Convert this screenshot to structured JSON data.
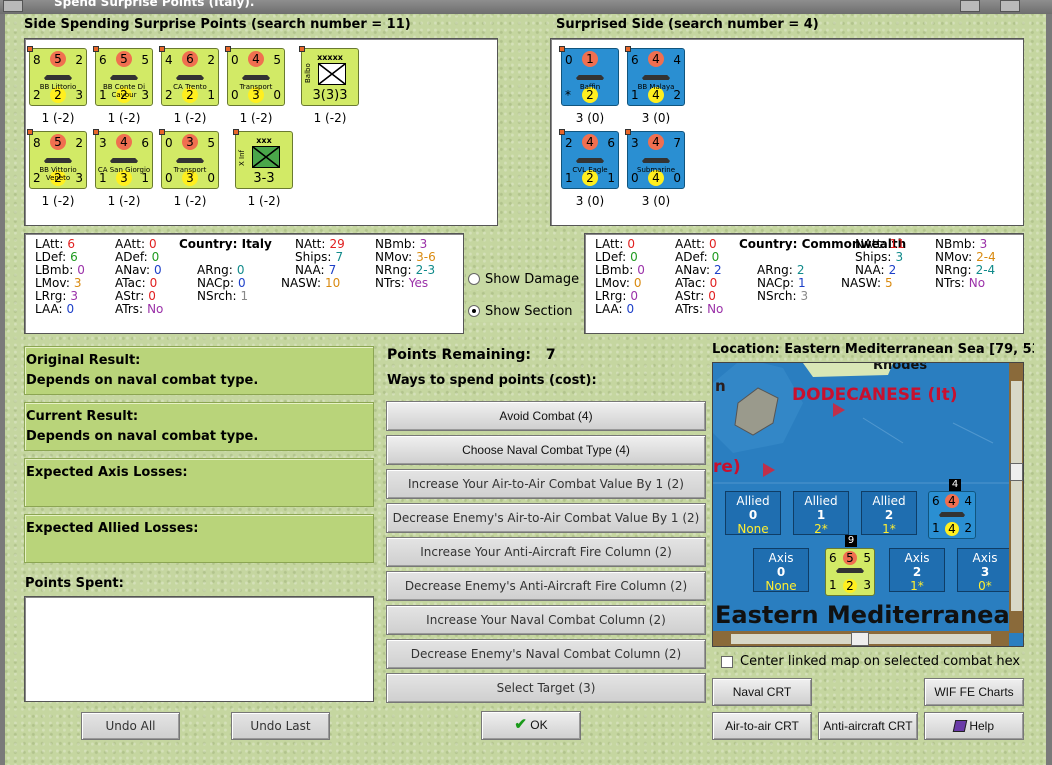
{
  "window": {
    "title": "Spend Surprise Points (Italy)."
  },
  "left_section": {
    "title": "Side Spending Surprise Points (search number = 11)"
  },
  "right_section": {
    "title": "Surprised Side (search number = 4)"
  },
  "left_units": [
    {
      "tl": "8",
      "tm": "5",
      "tr": "2",
      "bl": "2",
      "bm": "2",
      "br": "3",
      "name": "BB Littorio",
      "caption": "1 (-2)"
    },
    {
      "tl": "6",
      "tm": "5",
      "tr": "5",
      "bl": "1",
      "bm": "2",
      "br": "3",
      "name": "BB Conte Di Cavour",
      "caption": "1 (-2)"
    },
    {
      "tl": "4",
      "tm": "6",
      "tr": "2",
      "bl": "2",
      "bm": "2",
      "br": "1",
      "name": "CA Trento",
      "caption": "1 (-2)"
    },
    {
      "tl": "0",
      "tm": "4",
      "tr": "5",
      "bl": "0",
      "bm": "3",
      "br": "0",
      "name": "Transport",
      "caption": "1 (-2)"
    },
    {
      "label": "xxxxx",
      "side": "Balbo",
      "value": "3(3)3",
      "caption": "1 (-2)"
    },
    {
      "tl": "8",
      "tm": "5",
      "tr": "2",
      "bl": "2",
      "bm": "2",
      "br": "3",
      "name": "BB Vittorio Veneto",
      "caption": "1 (-2)"
    },
    {
      "tl": "3",
      "tm": "4",
      "tr": "6",
      "bl": "1",
      "bm": "3",
      "br": "1",
      "name": "CA San Giorgio",
      "caption": "1 (-2)"
    },
    {
      "tl": "0",
      "tm": "3",
      "tr": "5",
      "bl": "0",
      "bm": "3",
      "br": "0",
      "name": "Transport",
      "caption": "1 (-2)"
    },
    {
      "label": "xxx",
      "side": "X Inf",
      "value": "3-3",
      "caption": "1 (-2)"
    }
  ],
  "right_units": [
    {
      "tl": "0",
      "tm": "1",
      "tr": "",
      "bl": "*",
      "bm": "2",
      "br": "",
      "name": "Baffin",
      "caption": "3 (0)"
    },
    {
      "tl": "6",
      "tm": "4",
      "tr": "4",
      "bl": "1",
      "bm": "4",
      "br": "2",
      "name": "BB Malaya",
      "caption": "3 (0)"
    },
    {
      "tl": "2",
      "tm": "4",
      "tr": "6",
      "bl": "1",
      "bm": "2",
      "br": "1",
      "name": "CVL Eagle",
      "caption": "3 (0)"
    },
    {
      "tl": "3",
      "tm": "4",
      "tr": "7",
      "bl": "0",
      "bm": "4",
      "br": "0",
      "name": "Submarine",
      "caption": "3 (0)"
    }
  ],
  "left_stats": {
    "country_label": "Country:",
    "country": "Italy",
    "rows": [
      [
        {
          "k": "LAtt:",
          "v": "6",
          "c": "red"
        },
        {
          "k": "AAtt:",
          "v": "0",
          "c": "red"
        },
        {
          "k": "NAtt:",
          "v": "29",
          "c": "red"
        },
        {
          "k": "NBmb:",
          "v": "3",
          "c": "pur"
        }
      ],
      [
        {
          "k": "LDef:",
          "v": "6",
          "c": "grn"
        },
        {
          "k": "ADef:",
          "v": "0",
          "c": "grn"
        },
        {
          "k": "Ships:",
          "v": "7",
          "c": "tea"
        },
        {
          "k": "NMov:",
          "v": "3-6",
          "c": "org"
        }
      ],
      [
        {
          "k": "LBmb:",
          "v": "0",
          "c": "pur"
        },
        {
          "k": "ANav:",
          "v": "0",
          "c": "blu"
        },
        {
          "k": "ARng:",
          "v": "0",
          "c": "tea"
        },
        {
          "k": "NAA:",
          "v": "7",
          "c": "blu"
        },
        {
          "k": "NRng:",
          "v": "2-3",
          "c": "tea"
        }
      ],
      [
        {
          "k": "LMov:",
          "v": "3",
          "c": "org"
        },
        {
          "k": "ATac:",
          "v": "0",
          "c": "red"
        },
        {
          "k": "NACp:",
          "v": "0",
          "c": "blu"
        },
        {
          "k": "NASW:",
          "v": "10",
          "c": "org"
        },
        {
          "k": "NTrs:",
          "v": "Yes",
          "c": "pur"
        }
      ],
      [
        {
          "k": "LRrg:",
          "v": "3",
          "c": "pur"
        },
        {
          "k": "AStr:",
          "v": "0",
          "c": "red"
        },
        {
          "k": "NSrch:",
          "v": "1",
          "c": "gry"
        }
      ],
      [
        {
          "k": "LAA:",
          "v": "0",
          "c": "blu"
        },
        {
          "k": "ATrs:",
          "v": "No",
          "c": "pur"
        }
      ]
    ]
  },
  "right_stats": {
    "country_label": "Country:",
    "country": "Commonwealth",
    "rows": [
      [
        {
          "k": "LAtt:",
          "v": "0",
          "c": "red"
        },
        {
          "k": "AAtt:",
          "v": "0",
          "c": "red"
        },
        {
          "k": "NAtt:",
          "v": "11",
          "c": "red"
        },
        {
          "k": "NBmb:",
          "v": "3",
          "c": "pur"
        }
      ],
      [
        {
          "k": "LDef:",
          "v": "0",
          "c": "grn"
        },
        {
          "k": "ADef:",
          "v": "0",
          "c": "grn"
        },
        {
          "k": "Ships:",
          "v": "3",
          "c": "tea"
        },
        {
          "k": "NMov:",
          "v": "2-4",
          "c": "org"
        }
      ],
      [
        {
          "k": "LBmb:",
          "v": "0",
          "c": "pur"
        },
        {
          "k": "ANav:",
          "v": "2",
          "c": "blu"
        },
        {
          "k": "ARng:",
          "v": "2",
          "c": "tea"
        },
        {
          "k": "NAA:",
          "v": "2",
          "c": "blu"
        },
        {
          "k": "NRng:",
          "v": "2-4",
          "c": "tea"
        }
      ],
      [
        {
          "k": "LMov:",
          "v": "0",
          "c": "org"
        },
        {
          "k": "ATac:",
          "v": "0",
          "c": "red"
        },
        {
          "k": "NACp:",
          "v": "1",
          "c": "blu"
        },
        {
          "k": "NASW:",
          "v": "5",
          "c": "org"
        },
        {
          "k": "NTrs:",
          "v": "No",
          "c": "pur"
        }
      ],
      [
        {
          "k": "LRrg:",
          "v": "0",
          "c": "pur"
        },
        {
          "k": "AStr:",
          "v": "0",
          "c": "red"
        },
        {
          "k": "NSrch:",
          "v": "3",
          "c": "gry"
        }
      ],
      [
        {
          "k": "LAA:",
          "v": "0",
          "c": "blu"
        },
        {
          "k": "ATrs:",
          "v": "No",
          "c": "pur"
        }
      ]
    ]
  },
  "options": {
    "show_damage": "Show Damage",
    "show_section": "Show Section",
    "selected": "show_section"
  },
  "results": {
    "original_label": "Original Result:",
    "original_value": "Depends on naval combat type.",
    "current_label": "Current Result:",
    "current_value": "Depends on naval combat type.",
    "axis_losses_label": "Expected Axis Losses:",
    "allied_losses_label": "Expected Allied Losses:",
    "points_spent_label": "Points Spent:"
  },
  "points": {
    "remaining_label": "Points Remaining:",
    "remaining_value": "7",
    "ways_label": "Ways to spend points (cost):"
  },
  "actions": [
    "Avoid Combat (4)",
    "Choose Naval Combat Type (4)",
    "Increase Your Air-to-Air Combat Value By 1 (2)",
    "Decrease Enemy's Air-to-Air Combat Value By 1 (2)",
    "Increase Your Anti-Aircraft Fire Column (2)",
    "Decrease Enemy's Anti-Aircraft Fire Column (2)",
    "Increase Your Naval Combat Column (2)",
    "Decrease Enemy's Naval Combat Column (2)",
    "Select Target (3)"
  ],
  "buttons": {
    "undo_all": "Undo All",
    "undo_last": "Undo Last",
    "ok": "OK",
    "naval_crt": "Naval CRT",
    "wif_charts": "WIF FE Charts",
    "air_crt": "Air-to-air CRT",
    "aa_crt": "Anti-aircraft CRT",
    "help": "Help"
  },
  "map": {
    "location": "Location: Eastern Mediterranean Sea [79, 53",
    "rhodes": "Rhodes",
    "dodecanese": "DODECANESE (It)",
    "partial_label": "re)",
    "n_label": "n",
    "sea_label": "Eastern Mediterranea",
    "allied_boxes": [
      {
        "t": "Allied",
        "n": "0",
        "s": "None"
      },
      {
        "t": "Allied",
        "n": "1",
        "s": "2*"
      },
      {
        "t": "Allied",
        "n": "2",
        "s": "1*"
      }
    ],
    "axis_boxes": [
      {
        "t": "Axis",
        "n": "0",
        "s": "None"
      },
      {
        "t": "Axis",
        "n": "2",
        "s": "1*"
      },
      {
        "t": "Axis",
        "n": "3",
        "s": "0*"
      }
    ],
    "stack_badge_top": "4",
    "stack_badge_bottom": "9",
    "center_checkbox": "Center linked map on selected combat hex"
  }
}
